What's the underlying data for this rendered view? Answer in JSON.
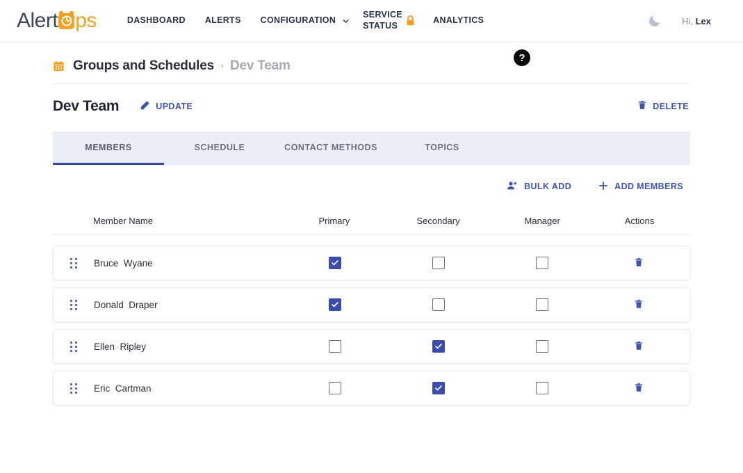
{
  "brand": {
    "name_dark": "Alert",
    "name_light": "ps",
    "logo_icon": "alarm-clock-icon",
    "color_orange": "#f5a11f",
    "color_dark": "#3c4657"
  },
  "topnav": {
    "links": [
      {
        "label": "DASHBOARD",
        "name": "dashboard"
      },
      {
        "label": "ALERTS",
        "name": "alerts"
      },
      {
        "label": "CONFIGURATION",
        "name": "configuration"
      },
      {
        "label": "SERVICE STATUS",
        "name": "service-status"
      },
      {
        "label": "ANALYTICS",
        "name": "analytics"
      }
    ],
    "chevron_icon": "chevron-down-icon",
    "lock_icon": "lock-icon",
    "theme_toggle_icon": "moon-icon",
    "greeting_prefix": "Hi, ",
    "greeting_user": "Lex"
  },
  "breadcrumb": {
    "icon": "calendar-icon",
    "parent": "Groups and Schedules",
    "separator": "›",
    "current": "Dev Team",
    "help_icon": "help-question-icon",
    "help_label": "?"
  },
  "title_row": {
    "title": "Dev Team",
    "update_label": "UPDATE",
    "update_icon": "pencil-icon",
    "delete_label": "DELETE",
    "delete_icon": "trash-icon"
  },
  "tabs": {
    "active_index": 0,
    "items": [
      {
        "label": "MEMBERS"
      },
      {
        "label": "SCHEDULE"
      },
      {
        "label": "CONTACT METHODS"
      },
      {
        "label": "TOPICS"
      }
    ]
  },
  "table_actions": {
    "bulk_add_label": "BULK ADD",
    "bulk_add_icon": "person-add-icon",
    "add_members_label": "ADD MEMBERS",
    "add_members_icon": "plus-icon"
  },
  "members_table": {
    "columns": [
      "Member Name",
      "Primary",
      "Secondary",
      "Manager",
      "Actions"
    ],
    "drag_handle_icon": "drag-handle-icon",
    "row_delete_icon": "trash-icon",
    "rows": [
      {
        "name": "Bruce  Wyane",
        "primary": true,
        "secondary": false,
        "manager": false
      },
      {
        "name": "Donald  Draper",
        "primary": true,
        "secondary": false,
        "manager": false
      },
      {
        "name": "Ellen  Ripley",
        "primary": false,
        "secondary": true,
        "manager": false
      },
      {
        "name": "Eric  Cartman",
        "primary": false,
        "secondary": true,
        "manager": false
      }
    ]
  },
  "colors": {
    "accent_indigo": "#3b4cac",
    "link_indigo": "#4054b2",
    "tab_bar_bg": "#eaeef7",
    "orange": "#f5a11f"
  }
}
